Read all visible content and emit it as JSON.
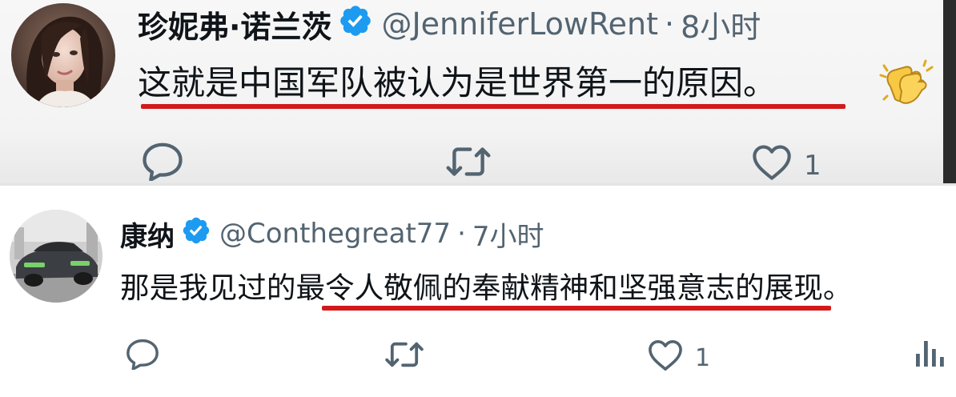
{
  "tweets": [
    {
      "display_name": "珍妮弗·诺兰茨",
      "handle": "@JenniferLowRent",
      "separator": "·",
      "time": "8小时",
      "text": "这就是中国军队被认为是世界第一的原因。",
      "emoji": "clapping-hands",
      "like_count": "1",
      "verified": true
    },
    {
      "display_name": "康纳",
      "handle": "@Conthegreat77",
      "separator": "·",
      "time": "7小时",
      "text": "那是我见过的最令人敬佩的奉献精神和坚强意志的展现。",
      "like_count": "1",
      "verified": true
    }
  ],
  "colors": {
    "verified_blue": "#1d9bf0",
    "underline_red": "#d21a1a",
    "meta_gray": "#536471",
    "text_black": "#0f1419"
  },
  "icons": {
    "reply": "reply-icon",
    "retweet": "retweet-icon",
    "like": "heart-icon",
    "views": "views-icon",
    "verified": "verified-badge-icon",
    "emoji": "clapping-hands-emoji-icon"
  }
}
